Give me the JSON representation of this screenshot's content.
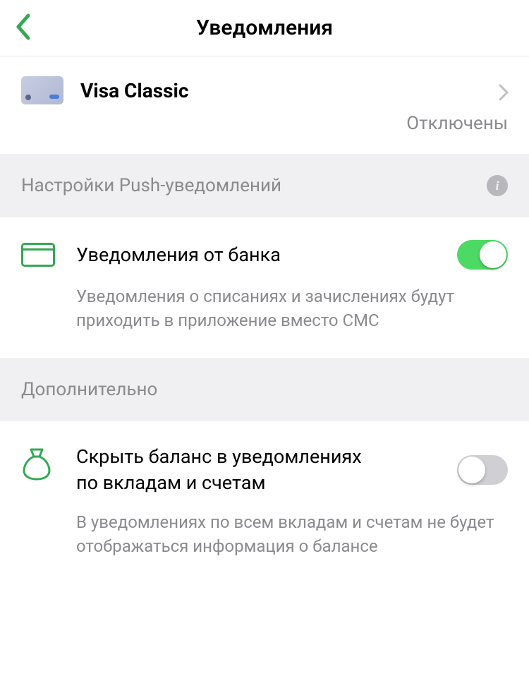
{
  "header": {
    "title": "Уведомления"
  },
  "card": {
    "name": "Visa Classic",
    "status": "Отключены"
  },
  "sections": {
    "push": {
      "header": "Настройки Push-уведомлений",
      "bank_notifications": {
        "title": "Уведомления от банка",
        "description": "Уведомления о списаниях и зачислениях будут приходить в приложение вместо СМС",
        "enabled": true
      }
    },
    "additional": {
      "header": "Дополнительно",
      "hide_balance": {
        "title": "Скрыть баланс в уведомлениях по вкладам и счетам",
        "description": "В уведомлениях по всем вкладам и счетам не будет отображаться информация о балансе",
        "enabled": false
      }
    }
  },
  "colors": {
    "accent": "#34a853",
    "toggle_on": "#4cd964"
  }
}
